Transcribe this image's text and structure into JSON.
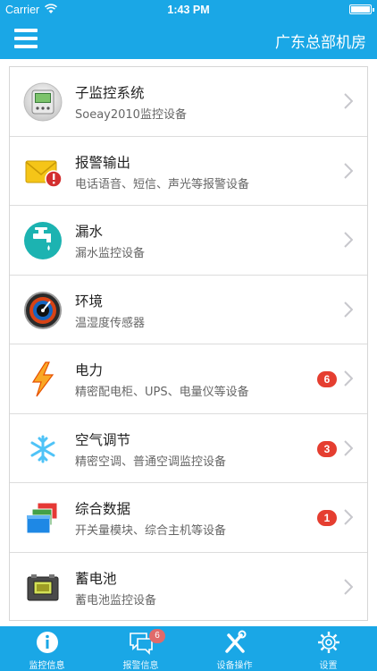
{
  "status_bar": {
    "carrier": "Carrier",
    "time": "1:43 PM"
  },
  "nav": {
    "title": "广东总部机房",
    "menu_icon": "hamburger-menu-icon"
  },
  "colors": {
    "primary": "#1aa7e6",
    "badge": "#e53e30",
    "divider": "#dcdcdc"
  },
  "list": [
    {
      "title": "子监控系统",
      "subtitle": "Soeay2010监控设备",
      "icon": "monitor-device-icon",
      "badge": null
    },
    {
      "title": "报警输出",
      "subtitle": "电话语音、短信、声光等报警设备",
      "icon": "alarm-mail-icon",
      "badge": null
    },
    {
      "title": "漏水",
      "subtitle": "漏水监控设备",
      "icon": "water-faucet-icon",
      "badge": null
    },
    {
      "title": "环境",
      "subtitle": "温湿度传感器",
      "icon": "environment-gauge-icon",
      "badge": null
    },
    {
      "title": "电力",
      "subtitle": "精密配电柜、UPS、电量仪等设备",
      "icon": "lightning-icon",
      "badge": "6"
    },
    {
      "title": "空气调节",
      "subtitle": "精密空调、普通空调监控设备",
      "icon": "snowflake-icon",
      "badge": "3"
    },
    {
      "title": "综合数据",
      "subtitle": "开关量模块、综合主机等设备",
      "icon": "data-windows-icon",
      "badge": "1"
    },
    {
      "title": "蓄电池",
      "subtitle": "蓄电池监控设备",
      "icon": "battery-device-icon",
      "badge": null
    }
  ],
  "tabs": [
    {
      "label": "监控信息",
      "icon": "info-icon",
      "badge": null,
      "active": true
    },
    {
      "label": "报警信息",
      "icon": "chat-bubbles-icon",
      "badge": "6",
      "active": false
    },
    {
      "label": "设备操作",
      "icon": "tools-icon",
      "badge": null,
      "active": false
    },
    {
      "label": "设置",
      "icon": "gear-icon",
      "badge": null,
      "active": false
    }
  ]
}
